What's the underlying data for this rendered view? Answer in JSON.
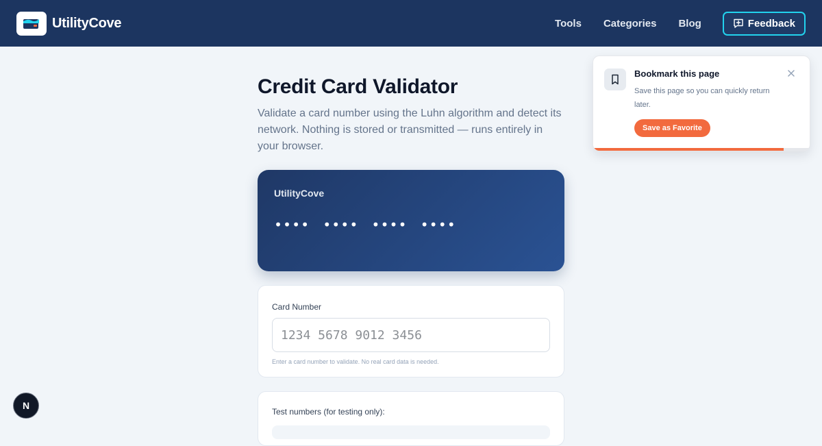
{
  "header": {
    "brand": "UtilityCove",
    "nav": [
      {
        "label": "Tools"
      },
      {
        "label": "Categories"
      },
      {
        "label": "Blog"
      }
    ],
    "feedback_label": "Feedback"
  },
  "page": {
    "title": "Credit Card Validator",
    "description": "Validate a card number using the Luhn algorithm and detect its network. Nothing is stored or transmitted — runs entirely in your browser."
  },
  "card_preview": {
    "brand": "UtilityCove",
    "number": "•••• •••• •••• ••••"
  },
  "card_input": {
    "label": "Card Number",
    "placeholder": "1234 5678 9012 3456",
    "value": "",
    "hint": "Enter a card number to validate. No real card data is needed."
  },
  "test_numbers": {
    "label": "Test numbers (for testing only):"
  },
  "bookmark_toast": {
    "title": "Bookmark this page",
    "text": "Save this page so you can quickly return later.",
    "button_label": "Save as Favorite",
    "close_icon": "close-icon",
    "progress": 0.88
  },
  "dev_badge": {
    "label": "N"
  },
  "colors": {
    "header_bg": "#1c3560",
    "accent_cyan": "#22d3ee",
    "accent_orange": "#f26a3e",
    "card_gradient_start": "#1f3866",
    "card_gradient_end": "#2a5293"
  }
}
